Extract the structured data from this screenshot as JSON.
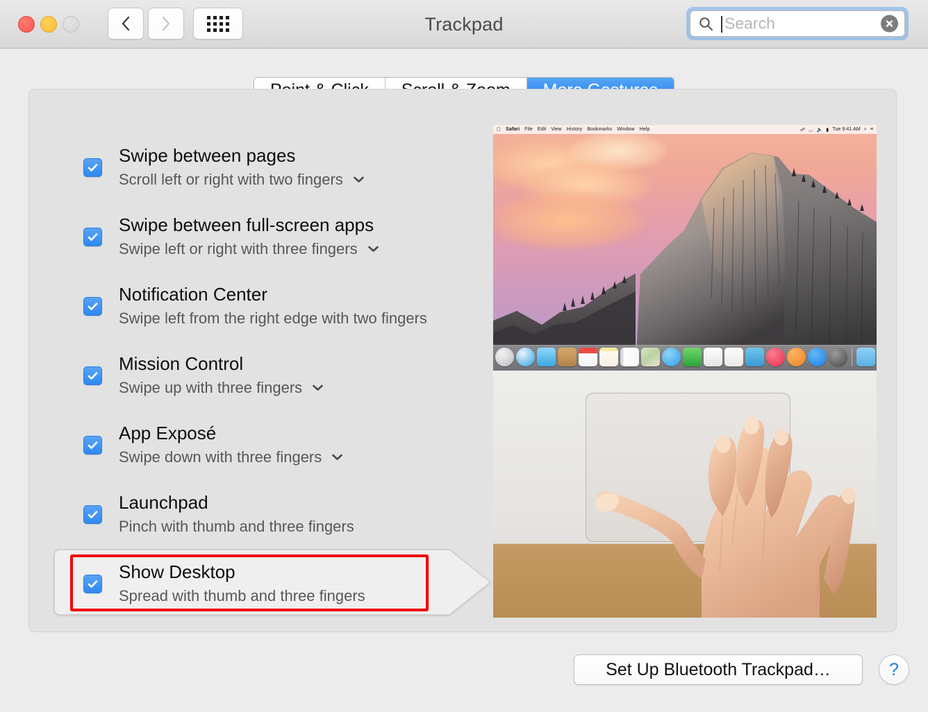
{
  "window": {
    "title": "Trackpad",
    "traffic_lights": [
      "close",
      "minimize",
      "zoom"
    ],
    "nav": {
      "back_icon": "chevron-left-icon",
      "forward_icon": "chevron-right-icon",
      "grid_icon": "show-all-grid-icon"
    }
  },
  "search": {
    "placeholder": "Search",
    "value": "",
    "icon": "search-icon",
    "clear_icon": "clear-circle-icon"
  },
  "tabs": [
    {
      "label": "Point & Click",
      "active": false
    },
    {
      "label": "Scroll & Zoom",
      "active": false
    },
    {
      "label": "More Gestures",
      "active": true
    }
  ],
  "gestures": [
    {
      "title": "Swipe between pages",
      "subtitle": "Scroll left or right with two fingers",
      "checked": true,
      "has_popup": true,
      "selected": false
    },
    {
      "title": "Swipe between full-screen apps",
      "subtitle": "Swipe left or right with three fingers",
      "checked": true,
      "has_popup": true,
      "selected": false
    },
    {
      "title": "Notification Center",
      "subtitle": "Swipe left from the right edge with two fingers",
      "checked": true,
      "has_popup": false,
      "selected": false
    },
    {
      "title": "Mission Control",
      "subtitle": "Swipe up with three fingers",
      "checked": true,
      "has_popup": true,
      "selected": false
    },
    {
      "title": "App Exposé",
      "subtitle": "Swipe down with three fingers",
      "checked": true,
      "has_popup": true,
      "selected": false
    },
    {
      "title": "Launchpad",
      "subtitle": "Pinch with thumb and three fingers",
      "checked": true,
      "has_popup": false,
      "selected": false
    },
    {
      "title": "Show Desktop",
      "subtitle": "Spread with thumb and three fingers",
      "checked": true,
      "has_popup": false,
      "selected": true
    }
  ],
  "preview": {
    "desktop": {
      "menu_items": [
        "Safari",
        "File",
        "Edit",
        "View",
        "History",
        "Bookmarks",
        "Window",
        "Help"
      ],
      "clock": "Tue 9:41 AM",
      "wallpaper": "Yosemite Half Dome at sunset",
      "dock_app_count": 19
    },
    "photo_caption": "Hand spreading thumb and three fingers on a trackpad"
  },
  "footer": {
    "setup_button": "Set Up Bluetooth Trackpad…",
    "help_button": "?"
  },
  "annotation": {
    "highlight_color": "#f20000",
    "highlighted_item": "Show Desktop"
  },
  "colors": {
    "accent_blue": "#2f88f1",
    "tab_active": "#1a7bf0",
    "window_bg": "#ececec",
    "panel_bg": "#e2e2e2",
    "help_blue": "#1878f0"
  }
}
